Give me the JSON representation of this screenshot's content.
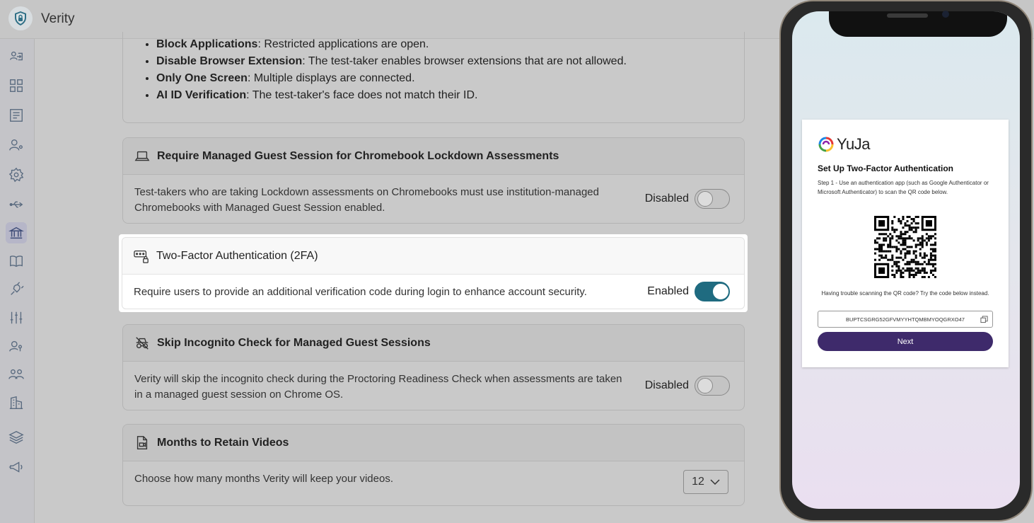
{
  "app": {
    "title": "Verity"
  },
  "bullets": [
    {
      "term": "Block Applications",
      "text": ": Restricted applications are open."
    },
    {
      "term": "Disable Browser Extension",
      "text": ": The test-taker enables browser extensions that are not allowed."
    },
    {
      "term": "Only One Screen",
      "text": ": Multiple displays are connected."
    },
    {
      "term": "AI ID Verification",
      "text": ": The test-taker's face does not match their ID."
    }
  ],
  "cards": {
    "chromebook": {
      "title": "Require Managed Guest Session for Chromebook Lockdown Assessments",
      "description": "Test-takers who are taking Lockdown assessments on Chromebooks must use institution-managed Chromebooks with Managed Guest Session enabled.",
      "status": "Disabled",
      "enabled": false
    },
    "twofa": {
      "title": "Two-Factor Authentication (2FA)",
      "description": "Require users to provide an additional verification code during login to enhance account security.",
      "status": "Enabled",
      "enabled": true
    },
    "incognito": {
      "title": "Skip Incognito Check for Managed Guest Sessions",
      "description": "Verity will skip the incognito check during the Proctoring Readiness Check when assessments are taken in a managed guest session on Chrome OS.",
      "status": "Disabled",
      "enabled": false
    },
    "retain": {
      "title": "Months to Retain Videos",
      "description": "Choose how many months Verity will keep your videos.",
      "value": "12"
    }
  },
  "phone": {
    "brand": "YuJa",
    "title": "Set Up Two-Factor Authentication",
    "step": "Step 1 - Use an authentication app (such as Google Authenticator or Microsoft Authenticator) to scan the QR code below.",
    "trouble": "Having trouble scanning the QR code? Try the code below instead.",
    "code": "BUPTCSGRG52GFVMYYHTQMBMYOQGRXO47",
    "next_label": "Next"
  },
  "colors": {
    "accent": "#1f6b80",
    "next_button": "#3e2a6b"
  }
}
